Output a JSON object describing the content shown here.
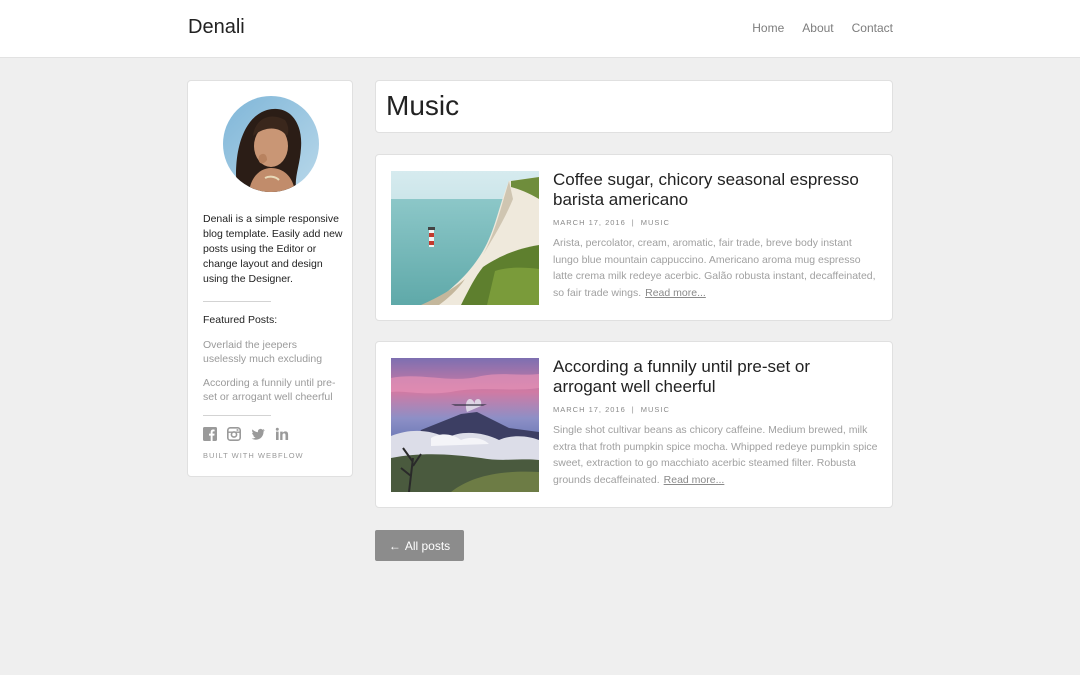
{
  "navbar": {
    "brand": "Denali",
    "links": [
      {
        "label": "Home"
      },
      {
        "label": "About"
      },
      {
        "label": "Contact"
      }
    ]
  },
  "sidebar": {
    "bio": "Denali is a simple responsive blog template. Easily add new posts using the Editor or change layout and design using the Designer.",
    "featured_title": "Featured Posts:",
    "featured_posts": [
      {
        "label": "Overlaid the jeepers uselessly much excluding"
      },
      {
        "label": "According a funnily until pre-set or arrogant well cheerful"
      }
    ],
    "social_icons": [
      "facebook-icon",
      "instagram-icon",
      "twitter-icon",
      "linkedin-icon"
    ],
    "built_with": "BUILT WITH WEBFLOW"
  },
  "category": {
    "title": "Music"
  },
  "posts": [
    {
      "title": "Coffee sugar, chicory seasonal espresso barista americano",
      "date": "MARCH 17, 2016",
      "separator": "|",
      "category": "MUSIC",
      "excerpt": "Arista, percolator, cream, aromatic, fair trade, breve body instant lungo blue mountain cappuccino. Americano aroma mug espresso latte crema milk redeye acerbic. Galão robusta instant, decaffeinated, so fair trade wings.",
      "read_more": "Read more...",
      "image": "coastal-cliff-lighthouse-photo"
    },
    {
      "title": "According a funnily until pre-set or arrogant well cheerful",
      "date": "MARCH 17, 2016",
      "separator": "|",
      "category": "MUSIC",
      "excerpt": "Single shot cultivar beans as chicory caffeine. Medium brewed, milk extra that froth pumpkin spice mocha. Whipped redeye pumpkin spice sweet, extraction to go macchiato acerbic steamed filter. Robusta grounds decaffeinated.",
      "read_more": "Read more...",
      "image": "volcano-sunrise-photo"
    }
  ],
  "back_button": {
    "arrow": "←",
    "label": "All posts"
  },
  "colors": {
    "page_background": "#efefef",
    "card_background": "#ffffff",
    "button_background": "#8c8c8c",
    "muted_text": "#a0a0a0"
  }
}
